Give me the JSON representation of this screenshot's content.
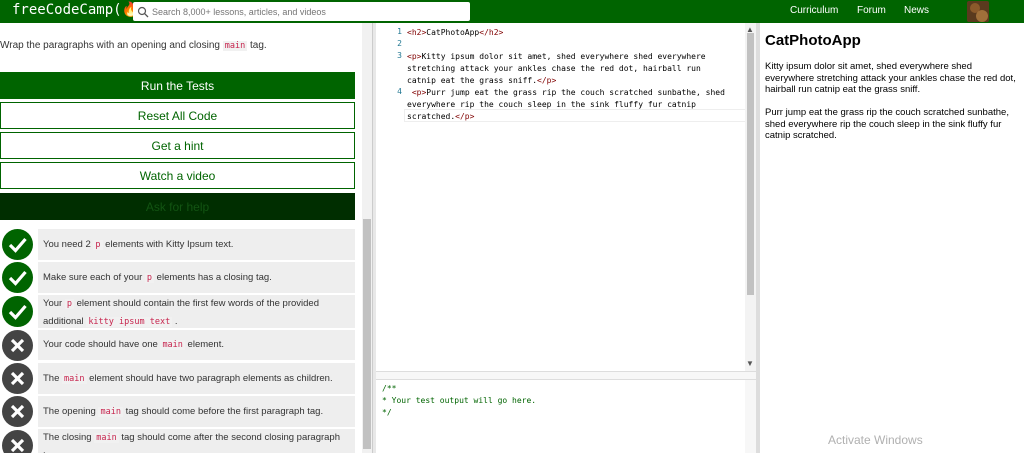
{
  "navbar": {
    "logo": "freeCodeCamp(🔥)",
    "search_placeholder": "Search 8,000+ lessons, articles, and videos",
    "links": [
      "Curriculum",
      "Forum",
      "News"
    ]
  },
  "instructions": {
    "before": "Wrap the paragraphs with an opening and closing ",
    "code": "main",
    "after": " tag."
  },
  "buttons": {
    "run": "Run the Tests",
    "reset": "Reset All Code",
    "hint": "Get a hint",
    "video": "Watch a video",
    "help": "Ask for help"
  },
  "tests": [
    {
      "status": "pass",
      "parts": [
        {
          "t": "You need 2 "
        },
        {
          "c": "p"
        },
        {
          "t": " elements with Kitty Ipsum text."
        }
      ]
    },
    {
      "status": "pass",
      "parts": [
        {
          "t": "Make sure each of your "
        },
        {
          "c": "p"
        },
        {
          "t": " elements has a closing tag."
        }
      ]
    },
    {
      "status": "pass",
      "parts": [
        {
          "t": "Your "
        },
        {
          "c": "p"
        },
        {
          "t": " element should contain the first few words of the provided additional "
        },
        {
          "c": "kitty ipsum text"
        },
        {
          "t": " ."
        }
      ]
    },
    {
      "status": "fail",
      "parts": [
        {
          "t": "Your code should have one "
        },
        {
          "c": "main"
        },
        {
          "t": " element."
        }
      ]
    },
    {
      "status": "fail",
      "parts": [
        {
          "t": "The "
        },
        {
          "c": "main"
        },
        {
          "t": " element should have two paragraph elements as children."
        }
      ]
    },
    {
      "status": "fail",
      "parts": [
        {
          "t": "The opening "
        },
        {
          "c": "main"
        },
        {
          "t": " tag should come before the first paragraph tag."
        }
      ]
    },
    {
      "status": "fail",
      "parts": [
        {
          "t": "The closing "
        },
        {
          "c": "main"
        },
        {
          "t": " tag should come after the second closing paragraph tag."
        }
      ]
    }
  ],
  "editor": {
    "line_numbers": [
      "1",
      "2",
      "3",
      "4"
    ],
    "lines": [
      "<h2>CatPhotoApp</h2>",
      "",
      "<p>Kitty ipsum dolor sit amet, shed everywhere shed everywhere",
      "stretching attack your ankles chase the red dot, hairball run",
      "catnip eat the grass sniff.</p>",
      " <p>Purr jump eat the grass rip the couch scratched sunbathe, shed",
      "everywhere rip the couch sleep in the sink fluffy fur catnip",
      "scratched.</p>"
    ]
  },
  "output": {
    "lines": [
      "/**",
      "* Your test output will go here.",
      "*/"
    ]
  },
  "preview": {
    "title": "CatPhotoApp",
    "p1": "Kitty ipsum dolor sit amet, shed everywhere shed everywhere stretching attack your ankles chase the red dot, hairball run catnip eat the grass sniff.",
    "p2": "Purr jump eat the grass rip the couch scratched sunbathe, shed everywhere rip the couch sleep in the sink fluffy fur catnip scratched."
  },
  "watermark": "Activate Windows",
  "colors": {
    "brand": "#006400",
    "help_bg": "#002e00",
    "fail": "#444444"
  }
}
